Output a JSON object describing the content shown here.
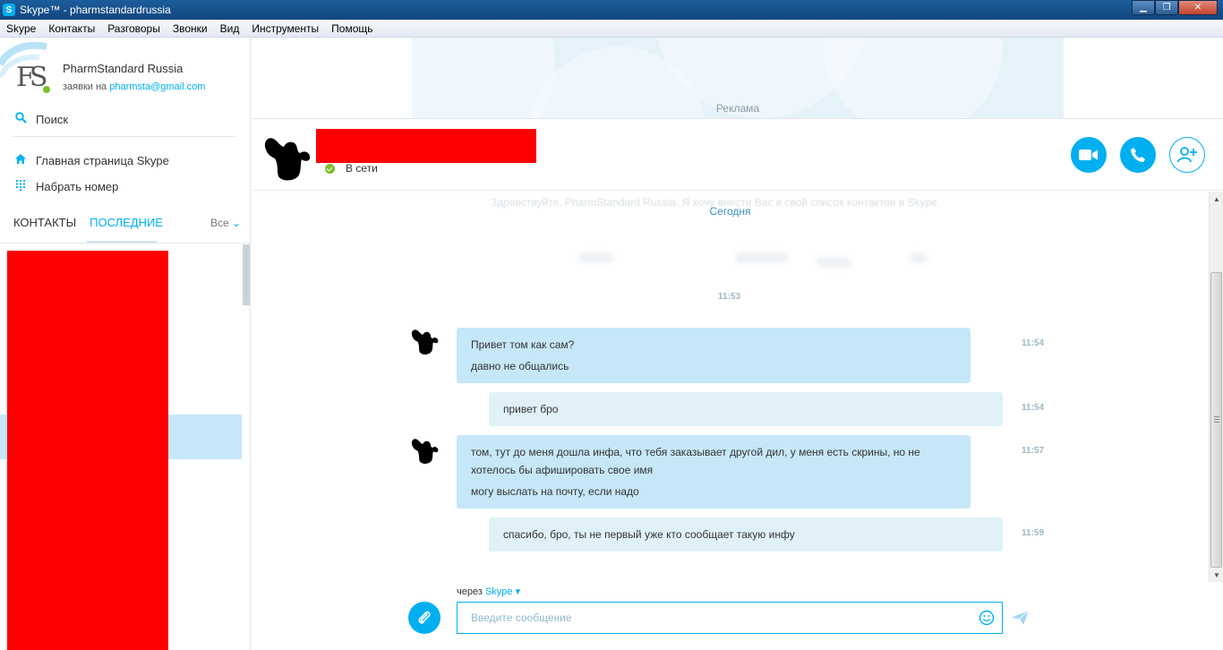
{
  "window": {
    "title": "Skype™ - pharmstandardrussia",
    "logo_letter": "S"
  },
  "menu": [
    "Skype",
    "Контакты",
    "Разговоры",
    "Звонки",
    "Вид",
    "Инструменты",
    "Помощь"
  ],
  "profile": {
    "name": "PharmStandard Russia",
    "mood_prefix": "заявки на",
    "mood_link": "pharmsta@gmail.com",
    "avatar_text": "FS"
  },
  "sidebar": {
    "search": "Поиск",
    "home": "Главная страница Skype",
    "dial": "Набрать номер",
    "tabs": {
      "contacts": "КОНТАКТЫ",
      "recent": "ПОСЛЕДНИЕ"
    },
    "filter": "Все"
  },
  "ad": {
    "label": "Реклама"
  },
  "contact": {
    "status": "В сети"
  },
  "chat": {
    "ghost_text": "Здравствуйте, PharmStandard Russia. Я хочу внести Вас в свой список контактов в Skype.",
    "day": "Сегодня",
    "center_time": "11:53",
    "messages": [
      {
        "dir": "in",
        "lines": [
          "Привет том как сам?",
          "давно не общались"
        ],
        "time": "11:54"
      },
      {
        "dir": "out",
        "lines": [
          "привет бро"
        ],
        "time": "11:54"
      },
      {
        "dir": "in",
        "lines": [
          "том, тут до меня дошла инфа, что тебя заказывает другой дил, у меня есть скрины, но не хотелось бы афишировать свое имя",
          "могу выслать на почту, если надо"
        ],
        "time": "11:57"
      },
      {
        "dir": "out",
        "lines": [
          "спасибо, бро, ты не первый уже кто сообщает такую инфу"
        ],
        "time": "11:59"
      }
    ]
  },
  "compose": {
    "via_prefix": "через",
    "via_service": "Skype",
    "placeholder": "Введите сообщение"
  },
  "colors": {
    "accent": "#00aff0",
    "incoming": "#c6e7f7",
    "outgoing": "#e0f1f9",
    "online": "#7cbf2b"
  }
}
